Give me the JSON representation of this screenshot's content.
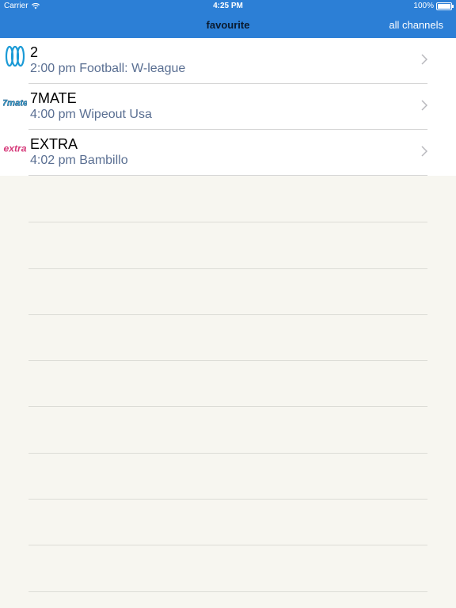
{
  "status_bar": {
    "carrier": "Carrier",
    "time": "4:25 PM",
    "battery": "100%",
    "battery_level": 1.0
  },
  "nav": {
    "title": "favourite",
    "right_button": "all channels"
  },
  "channels": [
    {
      "name": "2",
      "program": "2:00 pm Football: W-league",
      "logo": "abc-logo-icon"
    },
    {
      "name": "7MATE",
      "program": "4:00 pm Wipeout Usa",
      "logo": "7mate-logo-icon",
      "logo_text": "7mate"
    },
    {
      "name": "EXTRA",
      "program": "4:02 pm Bambillo",
      "logo": "extra-logo-icon",
      "logo_text": "extra"
    }
  ],
  "colors": {
    "accent": "#2c7fd6",
    "background": "#f7f6f0",
    "subtitle": "#5a6f92"
  }
}
